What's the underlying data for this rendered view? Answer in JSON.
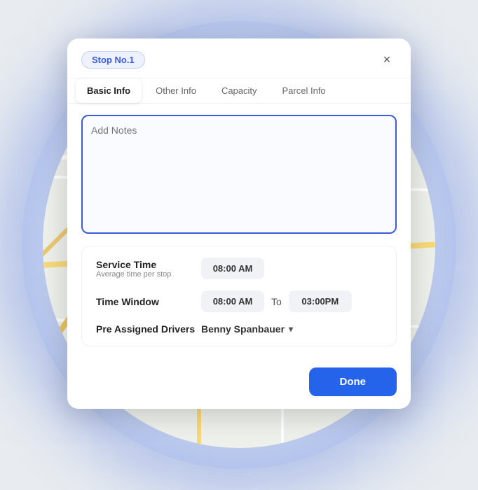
{
  "map": {
    "alt": "Street map background"
  },
  "modal": {
    "stop_badge": "Stop No.1",
    "close_label": "×",
    "tabs": [
      {
        "id": "basic-info",
        "label": "Basic Info",
        "active": true
      },
      {
        "id": "other-info",
        "label": "Other Info",
        "active": false
      },
      {
        "id": "capacity",
        "label": "Capacity",
        "active": false
      },
      {
        "id": "parcel-info",
        "label": "Parcel Info",
        "active": false
      }
    ],
    "notes_placeholder": "Add Notes",
    "service_time": {
      "label": "Service Time",
      "sublabel": "Average time per stop",
      "value": "08:00 AM"
    },
    "time_window": {
      "label": "Time Window",
      "from": "08:00 AM",
      "to_label": "To",
      "to": "03:00PM"
    },
    "pre_assigned_drivers": {
      "label": "Pre Assigned Drivers",
      "value": "Benny Spanbauer"
    },
    "done_button": "Done"
  }
}
